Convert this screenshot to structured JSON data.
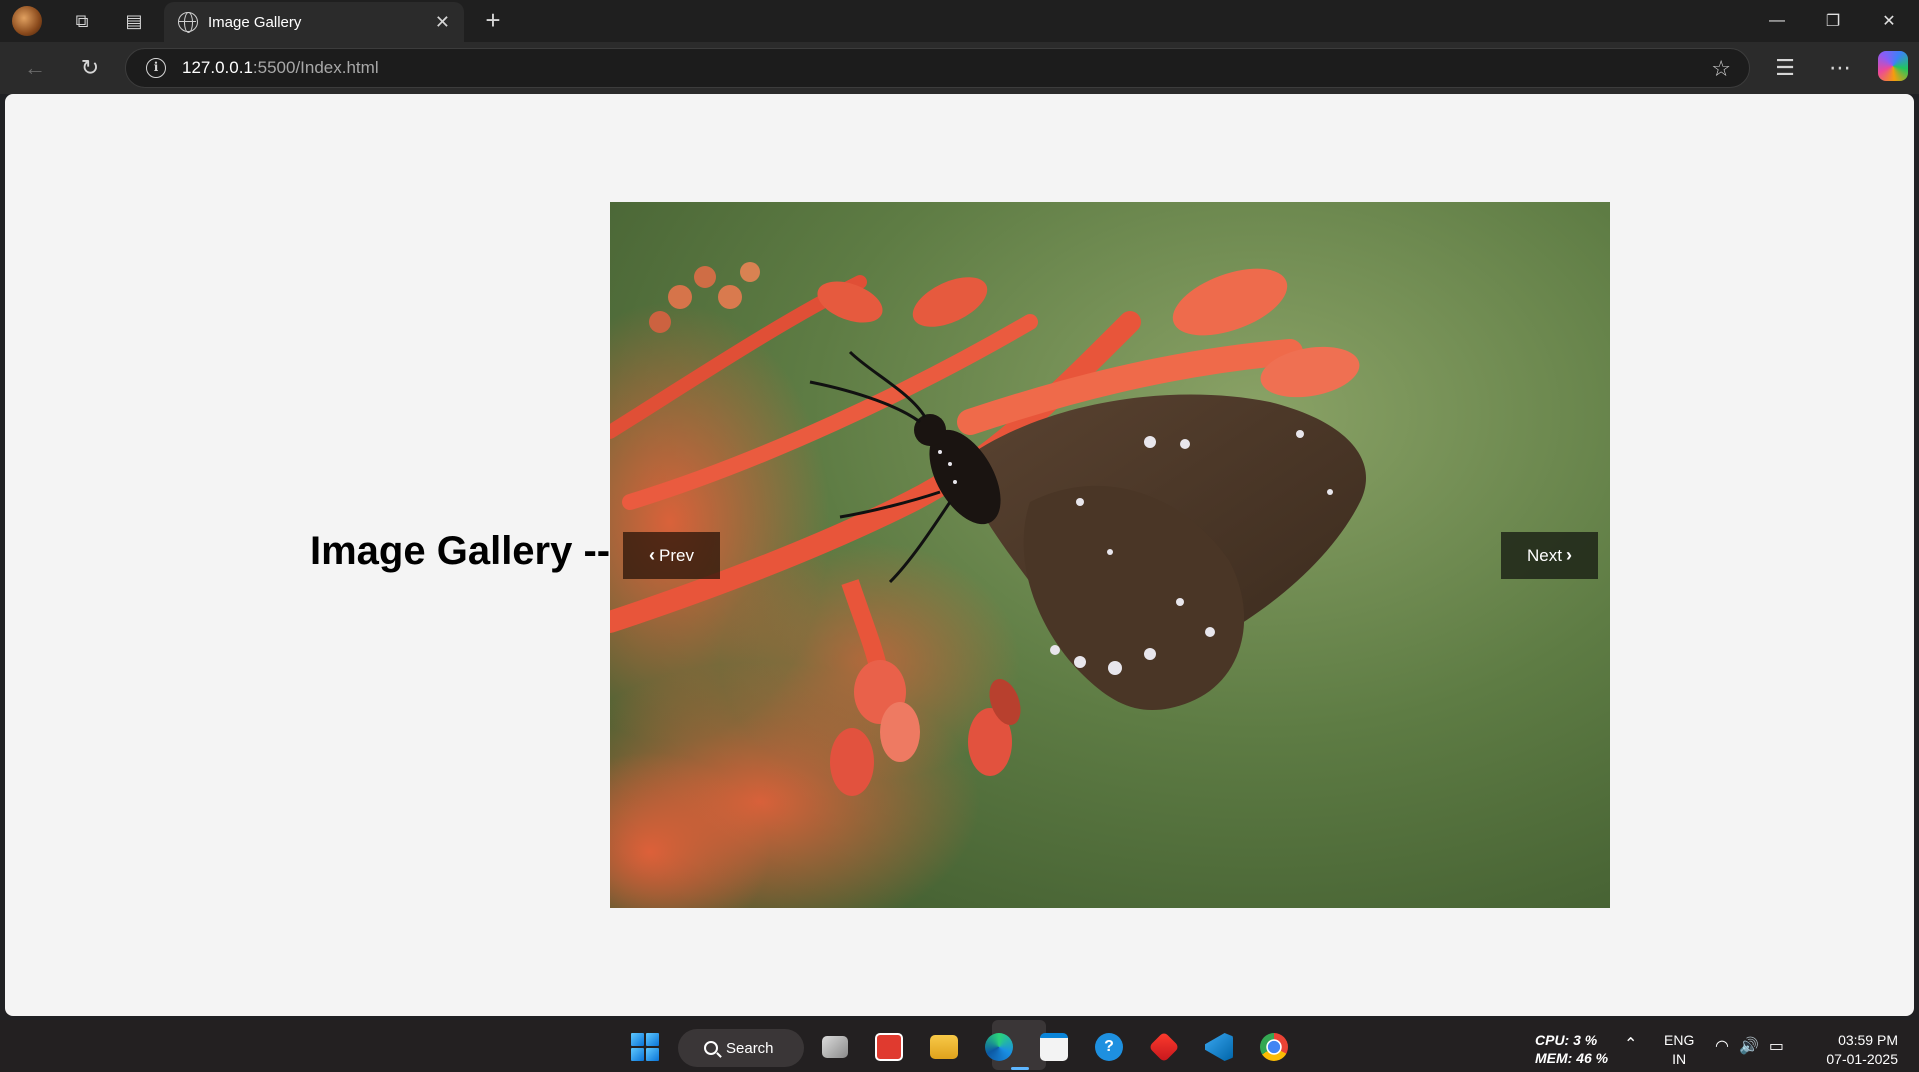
{
  "browser": {
    "tab_title": "Image Gallery",
    "url_host": "127.0.0.1",
    "url_path": ":5500/Index.html"
  },
  "page": {
    "heading": "Image Gallery --",
    "prev_label": "Prev",
    "next_label": "Next",
    "image_subject": "brown butterfly on red flower"
  },
  "taskbar": {
    "search_label": "Search",
    "cpu": "CPU: 3 %",
    "mem": "MEM: 46 %",
    "lang_top": "ENG",
    "lang_bottom": "IN",
    "time": "03:59 PM",
    "date": "07-01-2025"
  },
  "colors": {
    "page_bg": "#f4f4f4",
    "browser_bar": "#2b2b2b",
    "taskbar": "#232021",
    "accent": "#5eb6ff"
  }
}
